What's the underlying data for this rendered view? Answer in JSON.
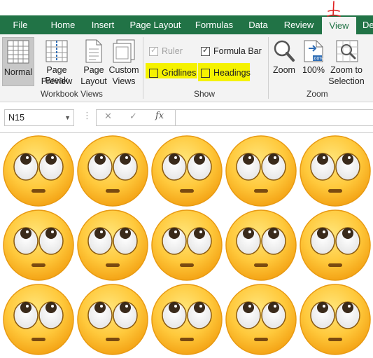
{
  "tabs": [
    {
      "label": "File"
    },
    {
      "label": "Home"
    },
    {
      "label": "Insert"
    },
    {
      "label": "Page Layout"
    },
    {
      "label": "Formulas"
    },
    {
      "label": "Data"
    },
    {
      "label": "Review"
    },
    {
      "label": "View"
    },
    {
      "label": "De"
    }
  ],
  "workbook_views": {
    "group_label": "Workbook Views",
    "normal": {
      "label": "Normal"
    },
    "page_break": {
      "line1": "Page Break",
      "line2": "Preview"
    },
    "page_layout": {
      "line1": "Page",
      "line2": "Layout"
    },
    "custom_views": {
      "line1": "Custom",
      "line2": "Views"
    }
  },
  "show": {
    "group_label": "Show",
    "ruler": {
      "label": "Ruler",
      "checked": true,
      "disabled": true
    },
    "formula_bar": {
      "label": "Formula Bar",
      "checked": true
    },
    "gridlines": {
      "label": "Gridlines",
      "checked": false
    },
    "headings": {
      "label": "Headings",
      "checked": false
    }
  },
  "zoom": {
    "group_label": "Zoom",
    "zoom": {
      "label": "Zoom"
    },
    "hundred": {
      "label": "100%"
    },
    "zoom_to_selection": {
      "line1": "Zoom to",
      "line2": "Selection"
    }
  },
  "formula_bar": {
    "name_box": "N15",
    "cancel_symbol": "✕",
    "enter_symbol": "✓",
    "fx_symbol": "fx",
    "more_symbol": "⋮",
    "formula_value": ""
  },
  "colors": {
    "tab_bar": "#217346",
    "ribbon": "#f3f3f3",
    "highlight": "#f5f200",
    "annotation": "#e02020"
  },
  "sheet": {
    "emoji_icon": "face-with-rolling-eyes-icon",
    "emoji_count": 15
  }
}
